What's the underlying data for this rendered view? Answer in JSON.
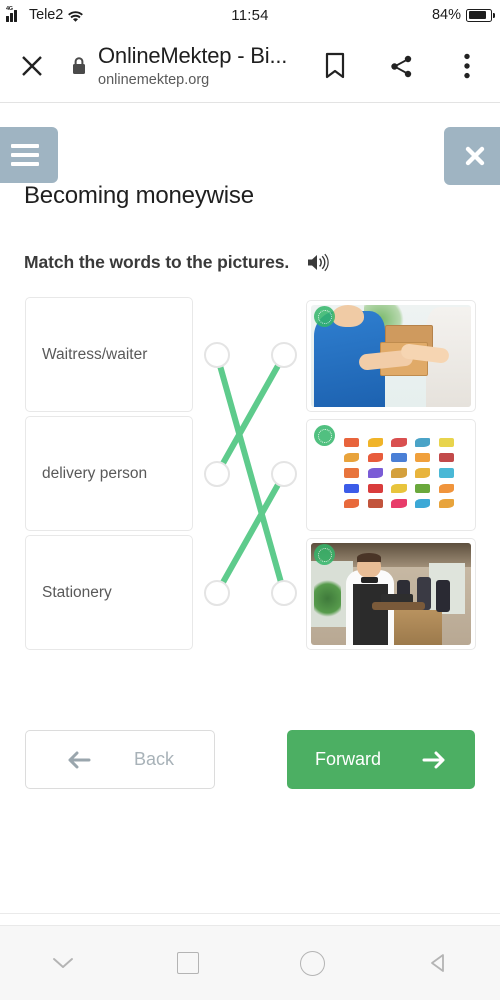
{
  "status_bar": {
    "network_type": "4G",
    "carrier": "Tele2",
    "wifi_icon": "wifi-icon",
    "time": "11:54",
    "battery_percent": "84%",
    "battery_level": 84
  },
  "browser": {
    "close_icon": "close-icon",
    "lock_icon": "lock-icon",
    "title": "OnlineMektep - Bi...",
    "url": "onlinemektep.org",
    "bookmark_icon": "bookmark-icon",
    "share_icon": "share-icon",
    "overflow_icon": "more-vertical-icon"
  },
  "app_header": {
    "menu_icon": "hamburger-menu-icon",
    "close_icon": "close-icon",
    "button_color": "#9fb4c2"
  },
  "lesson": {
    "title": "Becoming moneywise",
    "instruction": "Match the words to the pictures.",
    "audio_icon": "speaker-icon"
  },
  "matching": {
    "words": [
      {
        "label": "Waitress/waiter"
      },
      {
        "label": "delivery person"
      },
      {
        "label": "Stationery"
      }
    ],
    "pictures": [
      {
        "alt": "delivery person handing a cardboard box",
        "badge": "logo-badge"
      },
      {
        "alt": "grid of colourful stationery icons",
        "badge": "logo-badge"
      },
      {
        "alt": "waiter with bow tie holding a tray in a restaurant",
        "badge": "logo-badge"
      }
    ],
    "connections": [
      {
        "from": 0,
        "to": 2
      },
      {
        "from": 1,
        "to": 0
      },
      {
        "from": 2,
        "to": 1
      }
    ],
    "line_color": "#5ecb8c",
    "dot_border_color": "#e4e4e4",
    "stationery_icon_colors": [
      "#e8643c",
      "#f0b429",
      "#d94f4f",
      "#4aa3c7",
      "#e8d44d",
      "#e8a33c",
      "#e85c3c",
      "#4a7fd6",
      "#f0a03c",
      "#c24a4a",
      "#e8743c",
      "#7a5cd6",
      "#d4a03c",
      "#e8b43c",
      "#4ab8d6",
      "#3c5ce8",
      "#d93c3c",
      "#e8c43c",
      "#6aa83c",
      "#f0943c",
      "#e86a3c",
      "#c2543c",
      "#e83c6a",
      "#3ca8d6",
      "#e8a43c"
    ]
  },
  "nav_buttons": {
    "back": {
      "label": "Back",
      "icon": "arrow-left-icon",
      "disabled": true
    },
    "forward": {
      "label": "Forward",
      "icon": "arrow-right-icon",
      "color": "#4caf63"
    }
  },
  "system_nav": {
    "items": [
      {
        "icon": "chevron-down-icon"
      },
      {
        "icon": "recents-square-icon"
      },
      {
        "icon": "home-circle-icon"
      },
      {
        "icon": "back-triangle-icon"
      }
    ]
  }
}
